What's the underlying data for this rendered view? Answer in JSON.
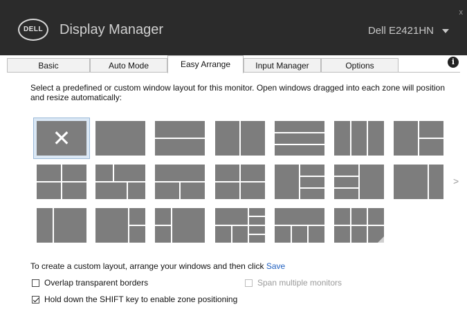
{
  "header": {
    "logo_text": "DELL",
    "app_title": "Display Manager",
    "monitor_name": "Dell E2421HN",
    "close_glyph": "x"
  },
  "tabs": [
    {
      "label": "Basic",
      "active": false
    },
    {
      "label": "Auto Mode",
      "active": false
    },
    {
      "label": "Easy Arrange",
      "active": true
    },
    {
      "label": "Input Manager",
      "active": false
    },
    {
      "label": "Options",
      "active": false
    }
  ],
  "description": "Select a predefined or custom window layout for this monitor.  Open windows dragged into each zone will position and resize automatically:",
  "layouts_selected_glyph": "✕",
  "next_glyph": ">",
  "custom_layout": {
    "text": "To create a custom layout, arrange your windows and then click",
    "save_link": "Save"
  },
  "options": [
    {
      "label": "Overlap transparent borders",
      "checked": false,
      "disabled": false
    },
    {
      "label": "Span multiple monitors",
      "checked": false,
      "disabled": true
    },
    {
      "label": "Hold down the SHIFT key to enable zone positioning",
      "checked": true,
      "disabled": false
    }
  ],
  "colors": {
    "header_bg": "#2b2b2b",
    "zone_fill": "#7d7d7d",
    "selection": "#dbe8f5",
    "link": "#1f5fbf"
  }
}
